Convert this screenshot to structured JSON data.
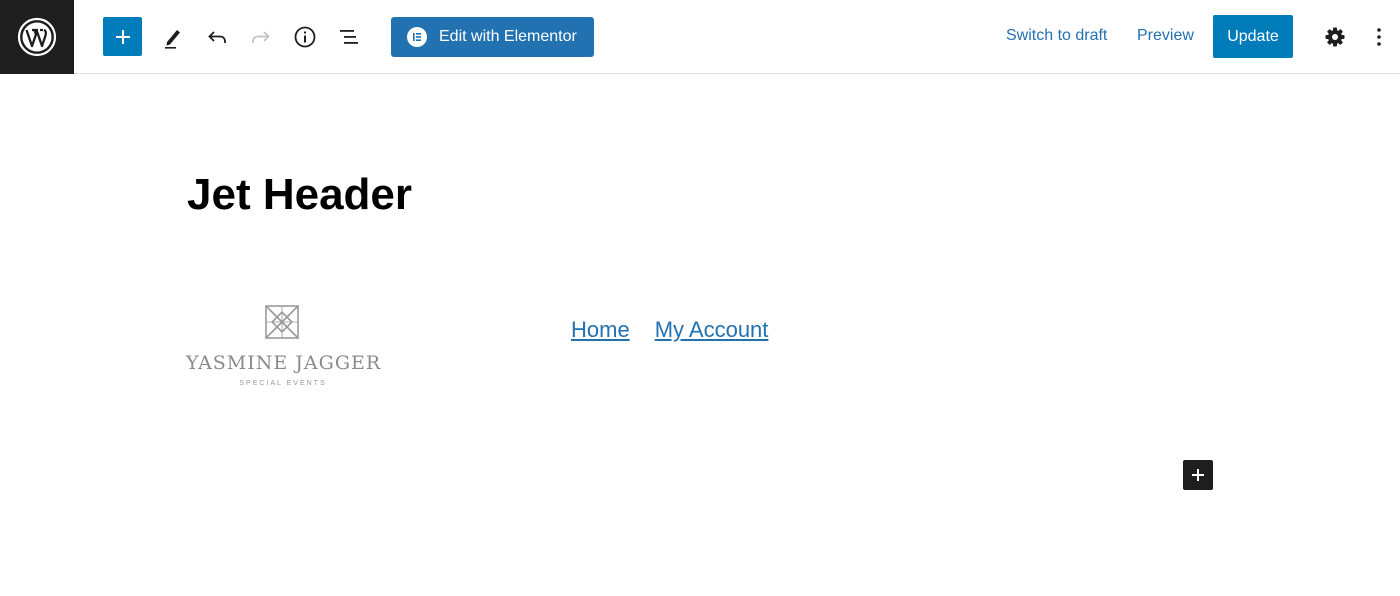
{
  "toolbar": {
    "logo_icon": "wordpress-logo-icon",
    "inserter_icon": "plus-icon",
    "tools_icon": "pencil-icon",
    "undo_icon": "undo-icon",
    "redo_icon": "redo-icon",
    "info_icon": "info-icon",
    "list_view_icon": "list-view-icon",
    "elementor_label": "Edit with Elementor",
    "switch_draft_label": "Switch to draft",
    "preview_label": "Preview",
    "update_label": "Update",
    "settings_icon": "gear-icon",
    "more_icon": "more-vertical-icon"
  },
  "content": {
    "title": "Jet Header",
    "logo": {
      "name": "YASMINE JAGGER",
      "tagline": "SPECIAL EVENTS"
    },
    "nav_links": [
      "Home",
      "My Account"
    ],
    "block_add_icon": "plus-icon"
  },
  "colors": {
    "accent": "#007cba",
    "elementor": "#2271b1",
    "link": "#2271b1",
    "dark": "#1e1e1e"
  }
}
